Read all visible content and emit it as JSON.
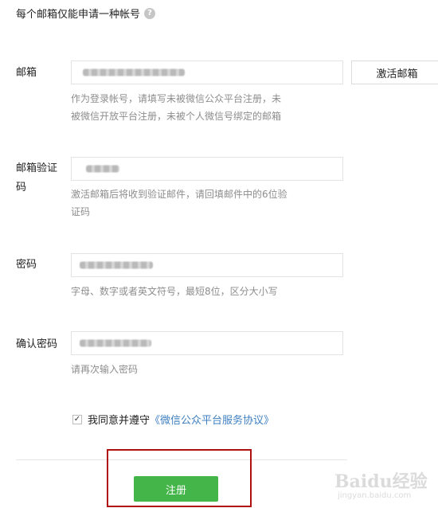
{
  "form": {
    "notice": "每个邮箱仅能申请一种帐号",
    "help_icon_glyph": "?",
    "email": {
      "label": "邮箱",
      "hint_line1": "作为登录帐号，请填写未被微信公众平台注册，未",
      "hint_line2": "被微信开放平台注册，未被个人微信号绑定的邮箱",
      "activate_button": "激活邮箱"
    },
    "code": {
      "label_line1": "邮箱验证",
      "label_line2": "码",
      "hint_line1": "激活邮箱后将收到验证邮件，请回填邮件中的6位验",
      "hint_line2": "证码"
    },
    "password": {
      "label": "密码",
      "hint": "字母、数字或者英文符号，最短8位，区分大小写"
    },
    "confirm": {
      "label": "确认密码",
      "hint": "请再次输入密码"
    },
    "agreement": {
      "checked_glyph": "✓",
      "text": "我同意并遵守",
      "link": "《微信公众平台服务协议》"
    },
    "submit_label": "注册"
  },
  "watermark": {
    "main": "Baidu经验",
    "sub": "jingyan.baidu.com"
  },
  "colors": {
    "primary_button": "#44b549",
    "link": "#3e7fc1",
    "highlight_box": "#b01010"
  }
}
